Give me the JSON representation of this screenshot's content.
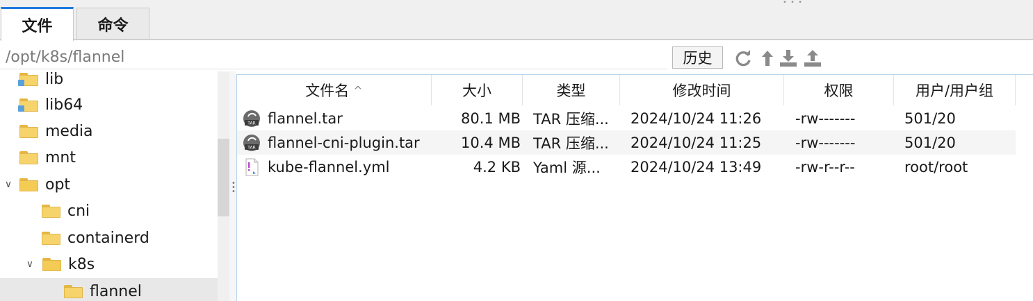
{
  "tabs": [
    {
      "label": "文件",
      "active": true
    },
    {
      "label": "命令",
      "active": false
    }
  ],
  "path_bar": {
    "path": "/opt/k8s/flannel",
    "history_label": "历史",
    "icons": [
      "refresh-icon",
      "go-up-icon",
      "download-icon",
      "upload-icon"
    ]
  },
  "tree": {
    "items": [
      {
        "label": "lib",
        "icon": "folder-link-icon"
      },
      {
        "label": "lib64",
        "icon": "folder-link-icon"
      },
      {
        "label": "media",
        "icon": "folder-icon"
      },
      {
        "label": "mnt",
        "icon": "folder-icon"
      },
      {
        "label": "opt",
        "icon": "folder-open-icon",
        "expanded": true
      },
      {
        "label": "cni",
        "icon": "folder-icon"
      },
      {
        "label": "containerd",
        "icon": "folder-icon"
      },
      {
        "label": "k8s",
        "icon": "folder-open-icon",
        "expanded": true
      },
      {
        "label": "flannel",
        "icon": "folder-icon",
        "selected": true
      }
    ]
  },
  "files": {
    "columns": [
      "文件名",
      "大小",
      "类型",
      "修改时间",
      "权限",
      "用户/用户组"
    ],
    "sort_indicator": "^",
    "rows": [
      {
        "name": "flannel.tar",
        "size": "80.1 MB",
        "type": "TAR 压缩...",
        "mtime": "2024/10/24 11:26",
        "perm": "-rw-------",
        "owner": "501/20",
        "icon": "tar-archive-icon"
      },
      {
        "name": "flannel-cni-plugin.tar",
        "size": "10.4 MB",
        "type": "TAR 压缩...",
        "mtime": "2024/10/24 11:25",
        "perm": "-rw-------",
        "owner": "501/20",
        "icon": "tar-archive-icon"
      },
      {
        "name": "kube-flannel.yml",
        "size": "4.2 KB",
        "type": "Yaml 源...",
        "mtime": "2024/10/24 13:49",
        "perm": "-rw-r--r--",
        "owner": "root/root",
        "icon": "yaml-file-icon"
      }
    ]
  },
  "colors": {
    "accent": "#1f7ae0",
    "folder": "#f7d46b",
    "selection": "#e8e8e8"
  }
}
